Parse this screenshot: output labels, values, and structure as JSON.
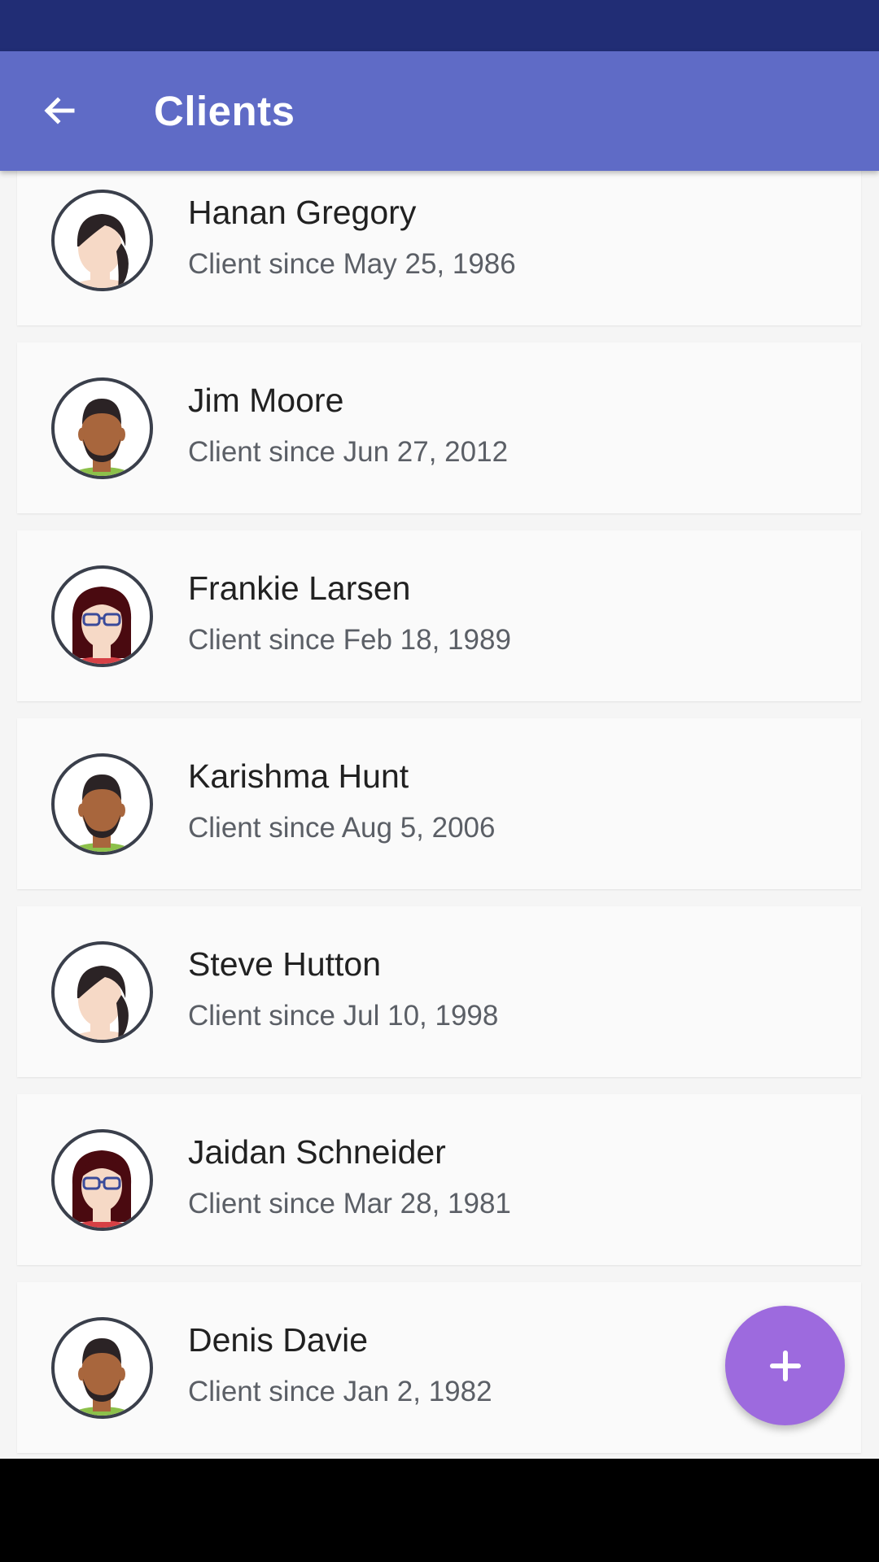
{
  "app_bar": {
    "title": "Clients",
    "back_icon": "arrow-back-icon",
    "background_color": "#5f6bc6",
    "status_bar_color": "#212d75"
  },
  "clients": [
    {
      "name": "Hanan Gregory",
      "since": "Client since May 25, 1986",
      "avatar": "woman-braid-avatar"
    },
    {
      "name": "Jim Moore",
      "since": "Client since Jun 27, 2012",
      "avatar": "man-beard-avatar"
    },
    {
      "name": "Frankie Larsen",
      "since": "Client since Feb 18, 1989",
      "avatar": "woman-glasses-avatar"
    },
    {
      "name": "Karishma Hunt",
      "since": "Client since Aug 5, 2006",
      "avatar": "man-beard-avatar"
    },
    {
      "name": "Steve Hutton",
      "since": "Client since Jul 10, 1998",
      "avatar": "woman-braid-avatar"
    },
    {
      "name": "Jaidan Schneider",
      "since": "Client since Mar 28, 1981",
      "avatar": "woman-glasses-avatar"
    },
    {
      "name": "Denis Davie",
      "since": "Client since Jan 2, 1982",
      "avatar": "man-beard-avatar"
    }
  ],
  "fab": {
    "icon": "plus-icon",
    "color": "#9d6ade"
  }
}
